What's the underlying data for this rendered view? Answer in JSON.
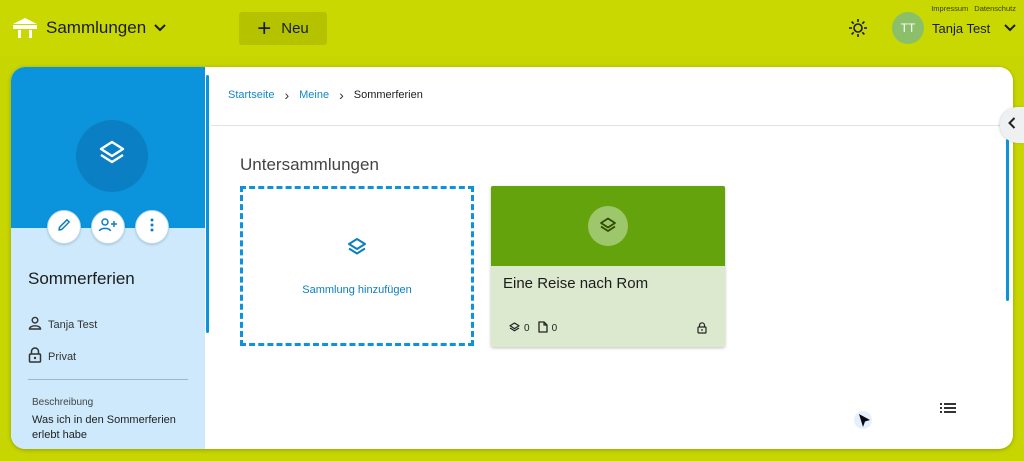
{
  "header": {
    "brand_label": "Sammlungen",
    "new_label": "Neu",
    "legal_links": [
      "Impressum",
      "Datenschutz"
    ],
    "user": {
      "initials": "TT",
      "name": "Tanja Test"
    },
    "colors": {
      "bar": "#c8d800",
      "new_button": "#b4c200",
      "avatar": "#8cbf6a"
    }
  },
  "sidebar": {
    "title": "Sommerferien",
    "owner": "Tanja Test",
    "visibility": "Privat",
    "description_label": "Beschreibung",
    "description": "Was ich in den Sommerferien erlebt habe",
    "actions": [
      "pencil-icon",
      "add-person-icon",
      "more-vertical-icon"
    ],
    "colors": {
      "header": "#0b94dc",
      "body": "#cde9fb"
    }
  },
  "breadcrumb": {
    "items": [
      "Startseite",
      "Meine"
    ],
    "current": "Sommerferien"
  },
  "main": {
    "section_title": "Untersammlungen",
    "add_card_label": "Sammlung hinzufügen",
    "cards": [
      {
        "title": "Eine Reise nach Rom",
        "subcollections": "0",
        "materials": "0",
        "icon": "layers-icon",
        "locked": true
      }
    ],
    "colors": {
      "card_head": "#64a30b",
      "card_body": "#dce9cf",
      "accent": "#0b94dc"
    }
  }
}
